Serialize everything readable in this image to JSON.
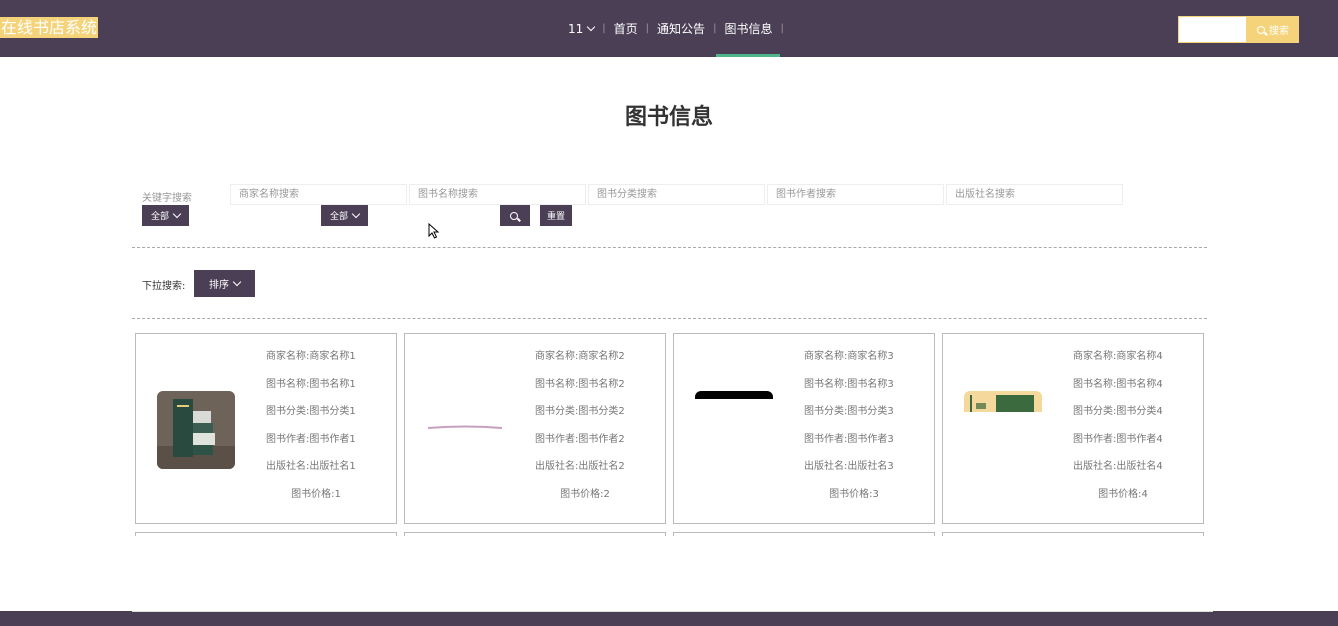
{
  "header": {
    "brand": "在线书店系统",
    "nav": [
      {
        "label": "11",
        "has_dropdown": true
      },
      {
        "label": "首页"
      },
      {
        "label": "通知公告"
      },
      {
        "label": "图书信息",
        "active": true
      }
    ],
    "search_button": "搜索"
  },
  "page": {
    "title": "图书信息"
  },
  "filters": {
    "keyword_label": "关键字搜索",
    "placeholders": {
      "merchant": "商家名称搜索",
      "book_name": "图书名称搜索",
      "category": "图书分类搜索",
      "author": "图书作者搜索",
      "publisher": "出版社名搜索"
    },
    "dropdown_all_1": "全部",
    "dropdown_all_2": "全部",
    "reset_button": "重置",
    "pull_label": "下拉搜索:",
    "sort_button": "排序"
  },
  "cards": [
    {
      "merchant": "商家名称:商家名称1",
      "name": "图书名称:图书名称1",
      "category": "图书分类:图书分类1",
      "author": "图书作者:图书作者1",
      "publisher": "出版社名:出版社名1",
      "price": "图书价格:1"
    },
    {
      "merchant": "商家名称:商家名称2",
      "name": "图书名称:图书名称2",
      "category": "图书分类:图书分类2",
      "author": "图书作者:图书作者2",
      "publisher": "出版社名:出版社名2",
      "price": "图书价格:2"
    },
    {
      "merchant": "商家名称:商家名称3",
      "name": "图书名称:图书名称3",
      "category": "图书分类:图书分类3",
      "author": "图书作者:图书作者3",
      "publisher": "出版社名:出版社名3",
      "price": "图书价格:3"
    },
    {
      "merchant": "商家名称:商家名称4",
      "name": "图书名称:图书名称4",
      "category": "图书分类:图书分类4",
      "author": "图书作者:图书作者4",
      "publisher": "出版社名:出版社名4",
      "price": "图书价格:4"
    }
  ],
  "colors": {
    "header_bg": "#4a3f55",
    "accent_yellow": "#f4d37a",
    "active_underline": "#4fb58a"
  }
}
